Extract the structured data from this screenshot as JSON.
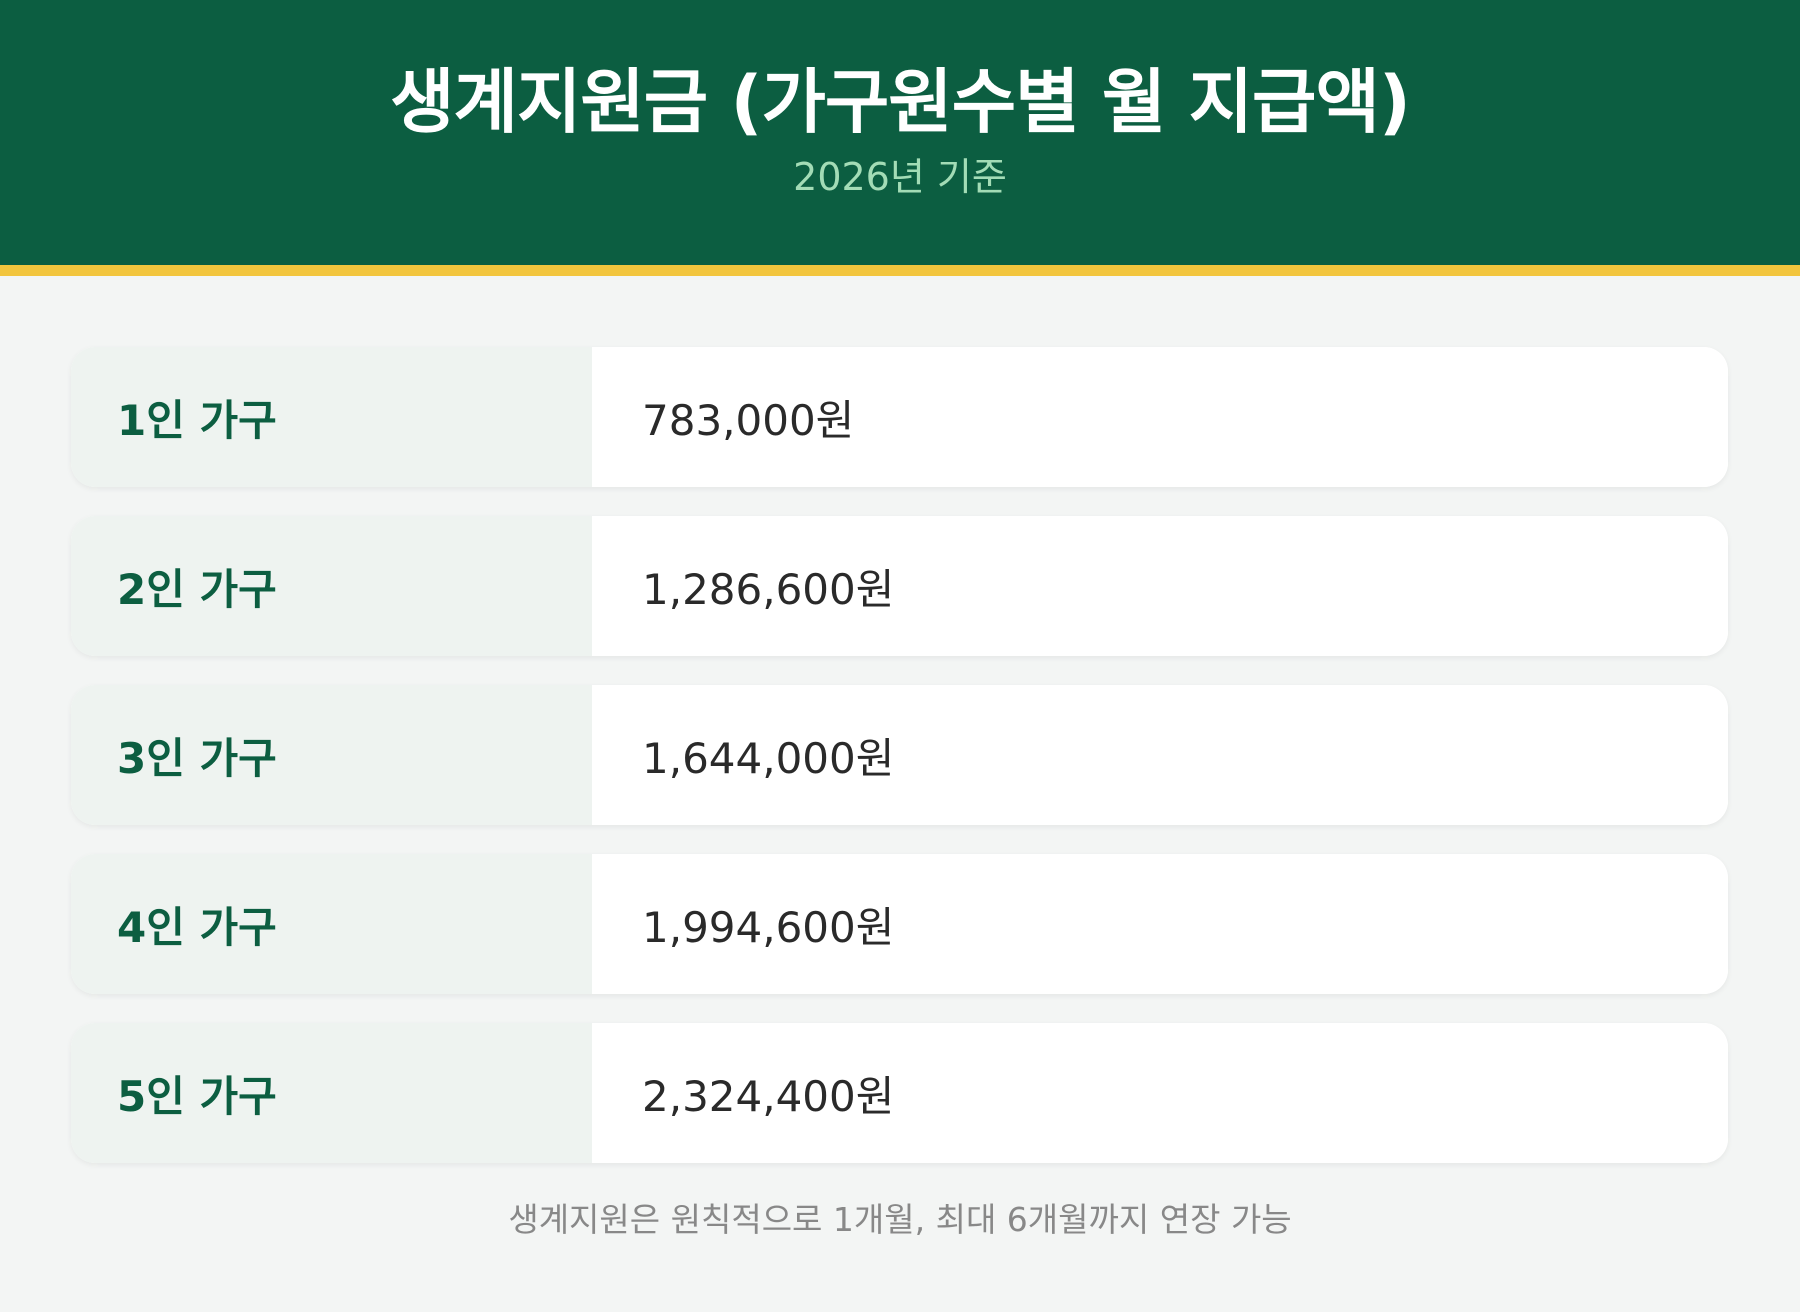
{
  "header": {
    "title": "생계지원금 (가구원수별 월 지급액)",
    "subtitle": "2026년 기준"
  },
  "rows": [
    {
      "label": "1인 가구",
      "value": "783,000원"
    },
    {
      "label": "2인 가구",
      "value": "1,286,600원"
    },
    {
      "label": "3인 가구",
      "value": "1,644,000원"
    },
    {
      "label": "4인 가구",
      "value": "1,994,600원"
    },
    {
      "label": "5인 가구",
      "value": "2,324,400원"
    }
  ],
  "footnote": "생계지원은 원칙적으로 1개월, 최대 6개월까지 연장 가능",
  "colors": {
    "header_bg": "#0c5e41",
    "accent_bar": "#f2c53d",
    "subtitle": "#a3dcb6",
    "label_text": "#0c5e41"
  }
}
